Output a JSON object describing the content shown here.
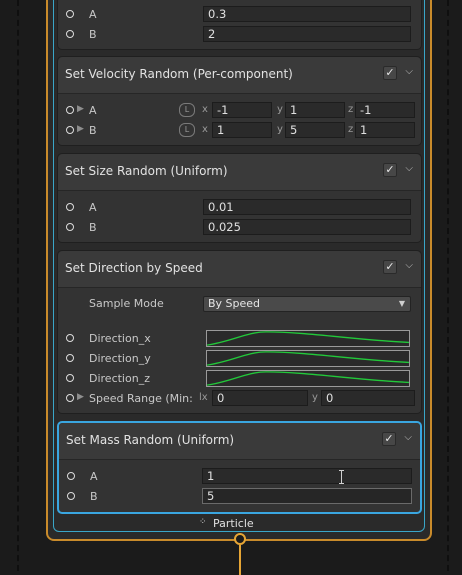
{
  "context": {
    "footer_label": "Particle"
  },
  "blocks": {
    "attribute_ab": {
      "a_label": "A",
      "a_value": "0.3",
      "b_label": "B",
      "b_value": "2"
    },
    "velocity": {
      "title": "Set Velocity Random (Per-component)",
      "space_badge": "L",
      "a_label": "A",
      "b_label": "B",
      "a": {
        "x": "-1",
        "y": "1",
        "z": "-1"
      },
      "b": {
        "x": "1",
        "y": "5",
        "z": "1"
      },
      "axis_x": "x",
      "axis_y": "y",
      "axis_z": "z"
    },
    "size": {
      "title": "Set Size Random (Uniform)",
      "a_label": "A",
      "a_value": "0.01",
      "b_label": "B",
      "b_value": "0.025"
    },
    "direction": {
      "title": "Set Direction by Speed",
      "sample_mode_label": "Sample Mode",
      "sample_mode_value": "By Speed",
      "dir_x": "Direction_x",
      "dir_y": "Direction_y",
      "dir_z": "Direction_z",
      "speed_range_label": "Speed Range (Min:",
      "speed_range_x_axis": "lx",
      "speed_range_x": "0",
      "speed_range_y_axis": "y",
      "speed_range_y": "0"
    },
    "mass": {
      "title": "Set Mass Random (Uniform)",
      "a_label": "A",
      "a_value": "1",
      "b_label": "B",
      "b_value": "5"
    }
  },
  "icons": {
    "check": "checkmark-icon",
    "chevron": "chevron-down-icon",
    "port": "input-port-icon",
    "expand": "expand-arrow-icon"
  },
  "colors": {
    "context_border": "#c98b2b",
    "selected_border": "#3aa6e0",
    "curve_color": "#22c93a",
    "output_port": "#e6a535"
  }
}
